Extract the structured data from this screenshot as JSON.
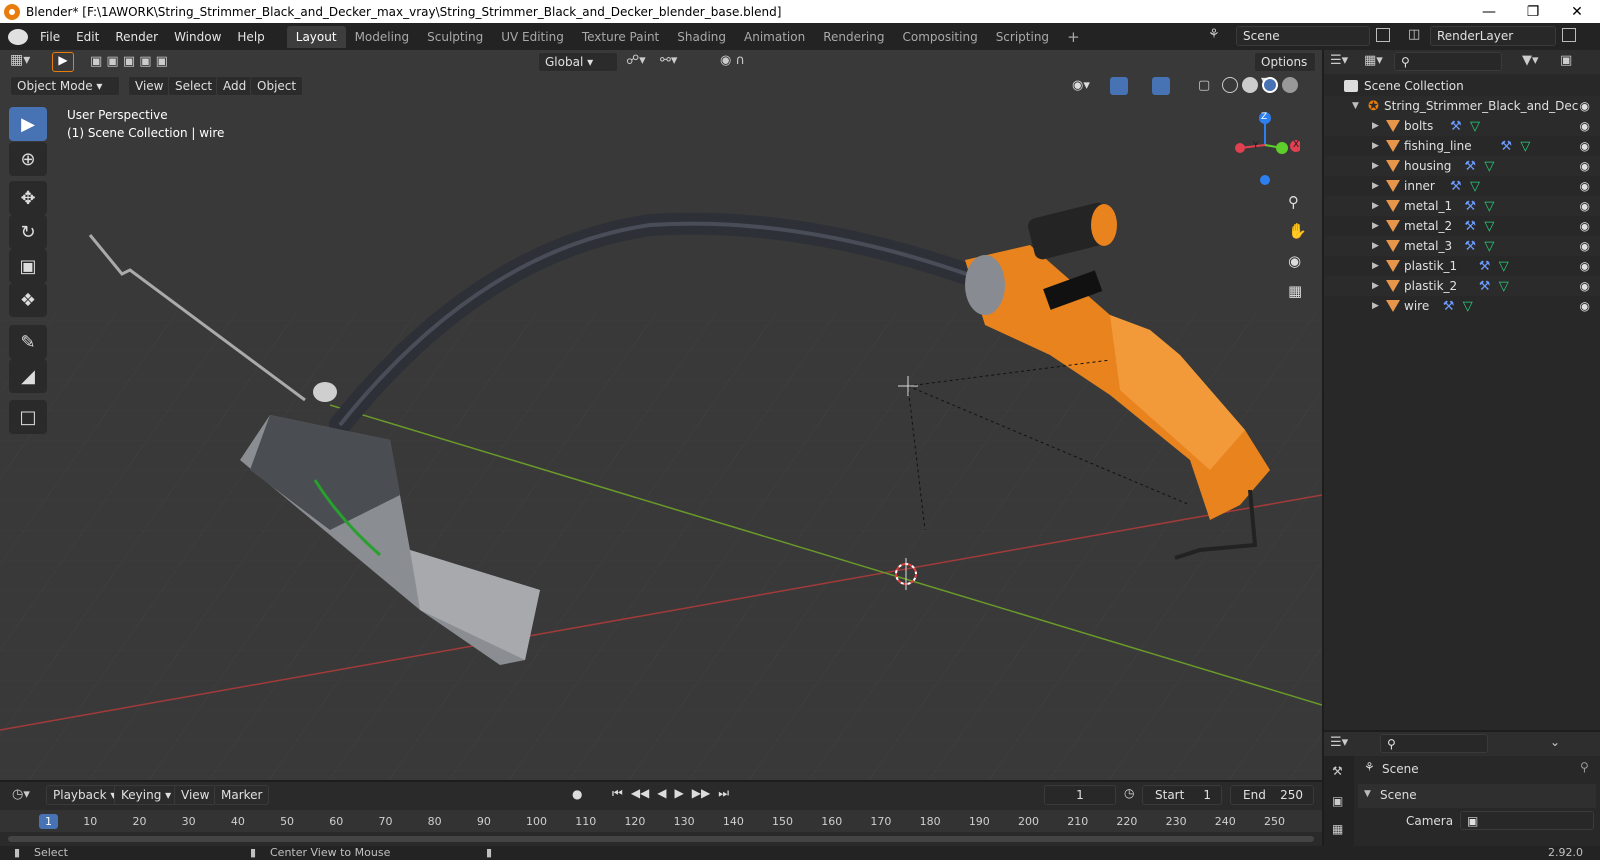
{
  "window": {
    "title": "Blender* [F:\\1AWORK\\String_Strimmer_Black_and_Decker_max_vray\\String_Strimmer_Black_and_Decker_blender_base.blend]"
  },
  "menus": [
    "File",
    "Edit",
    "Render",
    "Window",
    "Help"
  ],
  "workspaces": [
    "Layout",
    "Modeling",
    "Sculpting",
    "UV Editing",
    "Texture Paint",
    "Shading",
    "Animation",
    "Rendering",
    "Compositing",
    "Scripting"
  ],
  "scene_field": "Scene",
  "layer_field": "RenderLayer",
  "viewport": {
    "mode": "Object Mode",
    "menus": [
      "View",
      "Select",
      "Add",
      "Object"
    ],
    "orientation": "Global",
    "options_label": "Options",
    "overlay_title": "User Perspective",
    "overlay_sub": "(1) Scene Collection | wire",
    "gizmo": {
      "z": "Z",
      "y": "Y",
      "x": "X"
    }
  },
  "outliner": {
    "root": "Scene Collection",
    "collection": "String_Strimmer_Black_and_Dec",
    "objects": [
      "bolts",
      "fishing_line",
      "housing",
      "inner",
      "metal_1",
      "metal_2",
      "metal_3",
      "plastik_1",
      "plastik_2",
      "wire"
    ]
  },
  "properties": {
    "scene_header": "Scene",
    "panel": "Scene",
    "camera_label": "Camera"
  },
  "timeline": {
    "menus": [
      "Playback",
      "Keying",
      "View",
      "Marker"
    ],
    "current": "1",
    "start_label": "Start",
    "start": "1",
    "end_label": "End",
    "end": "250",
    "frames": [
      "1",
      "10",
      "20",
      "30",
      "40",
      "50",
      "60",
      "70",
      "80",
      "90",
      "100",
      "110",
      "120",
      "130",
      "140",
      "150",
      "160",
      "170",
      "180",
      "190",
      "200",
      "210",
      "220",
      "230",
      "240",
      "250"
    ]
  },
  "status": {
    "select": "Select",
    "center": "Center View to Mouse",
    "version": "2.92.0"
  },
  "colors": {
    "accent": "#4772b3",
    "orange": "#e87d0d",
    "axis_x": "#a33a3a",
    "axis_y": "#6a9a2a"
  }
}
